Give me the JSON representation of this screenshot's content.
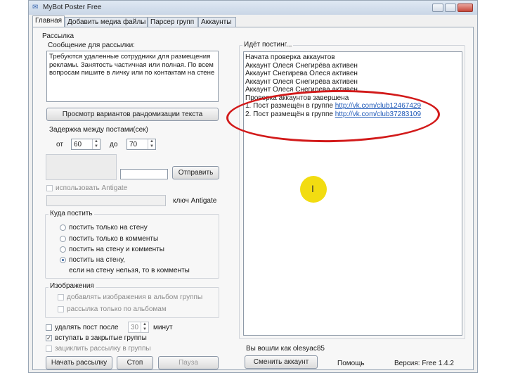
{
  "window": {
    "title": "MyBot Poster Free"
  },
  "tabs": [
    {
      "label": "Главная",
      "active": true
    },
    {
      "label": "Добавить медиа файлы",
      "active": false
    },
    {
      "label": "Парсер групп",
      "active": false
    },
    {
      "label": "Аккаунты",
      "active": false
    }
  ],
  "mailing": {
    "section_label": "Рассылка",
    "message_label": "Сообщение для рассылки:",
    "message_text": "Требуются удаленные сотрудники для размещения рекламы. Занятость частичная или полная. По всем вопросам пишите в личку или по контактам на стене",
    "randomize_button": "Просмотр вариантов рандомизации текста",
    "delay_label": "Задержка между постами(сек)",
    "from_label": "от",
    "from_value": "60",
    "to_label": "до",
    "to_value": "70",
    "send_button": "Отправить",
    "antigate_checkbox": "использовать Antigate",
    "antigate_key_label": "ключ Antigate"
  },
  "where_to_post": {
    "title": "Куда постить",
    "options": [
      {
        "line1": "постить только на стену",
        "line2": "",
        "selected": false
      },
      {
        "line1": "постить только в комменты",
        "line2": "",
        "selected": false
      },
      {
        "line1": "постить на стену и комменты",
        "line2": "",
        "selected": false
      },
      {
        "line1": "постить на стену,",
        "line2": "если на стену нельзя, то в комменты",
        "selected": true
      }
    ]
  },
  "images": {
    "title": "Изображения",
    "add_to_album": "добавлять изображения в альбом группы",
    "albums_only": "рассылка только по альбомам"
  },
  "options": {
    "delete_post_label": "удалять пост после",
    "delete_post_value": "30",
    "delete_post_unit": "минут",
    "join_closed": "вступать в закрытые группы",
    "loop_mailing": "зациклить рассылку в группы"
  },
  "buttons": {
    "start": "Начать рассылку",
    "stop": "Стоп",
    "pause": "Пауза",
    "change_account": "Сменить аккаунт"
  },
  "log": {
    "title": "Идёт постинг...",
    "lines": [
      {
        "text": "Начата проверка аккаунтов",
        "link": ""
      },
      {
        "text": "Аккаунт Олеся Снегирёва активен",
        "link": ""
      },
      {
        "text": "Аккаунт Снегирева Олеся активен",
        "link": ""
      },
      {
        "text": "Аккаунт Олеся Снегирёва активен",
        "link": ""
      },
      {
        "text": "Аккаунт Олеся Снегирева активен",
        "link": ""
      },
      {
        "text": "Проверка аккаунтов завершена",
        "link": ""
      },
      {
        "text": "1. Пост размещён в группе ",
        "link": "http://vk.com/club12467429"
      },
      {
        "text": "2. Пост размещён в группе ",
        "link": "http://vk.com/club37283109"
      }
    ]
  },
  "footer": {
    "logged_in_as": "Вы вошли как olesyac85",
    "help": "Помощь",
    "version": "Версия: Free 1.4.2"
  },
  "colors": {
    "annotation_oval": "#d21a1a",
    "cursor_highlight": "#f2dc11",
    "link": "#1f59b8"
  }
}
